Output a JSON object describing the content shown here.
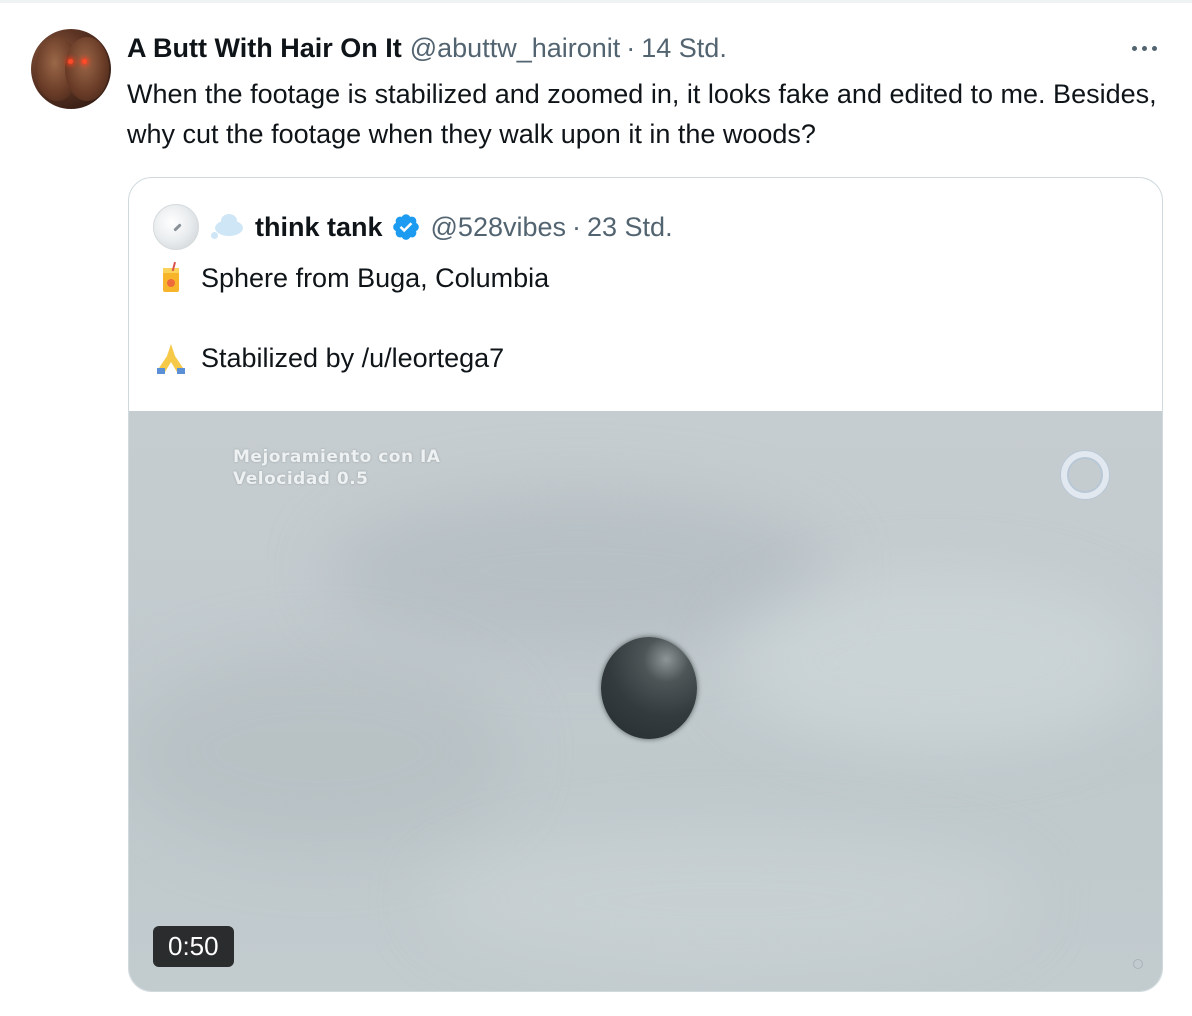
{
  "tweet": {
    "author_name": "A Butt With Hair On It",
    "author_handle": "@abuttw_haironit",
    "separator": "·",
    "timestamp": "14 Std.",
    "text": "When the footage is stabilized and zoomed in, it looks fake and edited to me. Besides, why cut the footage when they walk upon it in the woods?",
    "more_icon": "more-horizontal-icon"
  },
  "quoted_tweet": {
    "author_name": "think tank",
    "author_handle": "@528vibes",
    "separator": "·",
    "timestamp": "23 Std.",
    "verified": true,
    "lines": [
      {
        "emoji": "juice-box-emoji",
        "text": "Sphere from Buga, Columbia"
      },
      {
        "emoji": "folded-hands-emoji",
        "text": "Stabilized by /u/leortega7"
      }
    ],
    "media": {
      "overlay_line1": "Mejoramiento con IA",
      "overlay_line2": "Velocidad 0.5",
      "duration": "0:50"
    }
  },
  "colors": {
    "text_primary": "#0f1419",
    "text_secondary": "#536471",
    "border": "#cfd9de",
    "verified_blue": "#1d9bf0"
  }
}
